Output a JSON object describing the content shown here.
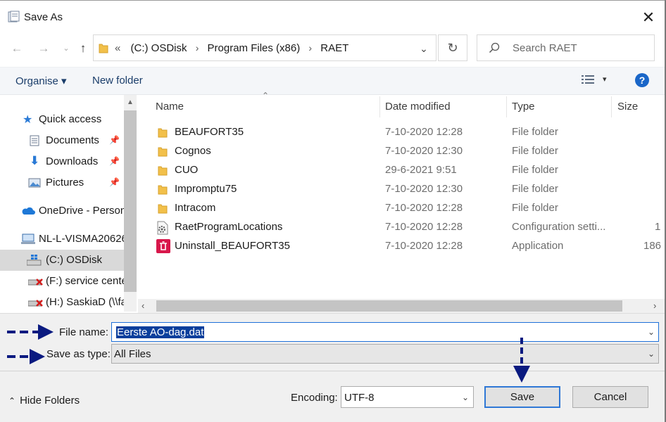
{
  "window": {
    "title": "Save As"
  },
  "address": {
    "crumbs": [
      "(C:) OSDisk",
      "Program Files (x86)",
      "RAET"
    ],
    "prefix": "«"
  },
  "search": {
    "placeholder": "Search RAET"
  },
  "toolbar": {
    "organise": "Organise ▾",
    "new_folder": "New folder"
  },
  "nav": {
    "items": [
      {
        "label": "Quick access",
        "icon": "star-icon"
      },
      {
        "label": "Documents",
        "icon": "documents-icon",
        "pinned": true
      },
      {
        "label": "Downloads",
        "icon": "download-arrow-icon",
        "pinned": true
      },
      {
        "label": "Pictures",
        "icon": "pictures-icon",
        "pinned": true
      },
      {
        "label": "OneDrive - Person",
        "icon": "cloud-icon"
      },
      {
        "label": "NL-L-VISMA20626",
        "icon": "computer-icon"
      },
      {
        "label": "(C:) OSDisk",
        "icon": "windows-drive-icon",
        "selected": true
      },
      {
        "label": "(F:) service cente",
        "icon": "network-drive-disconnected-icon"
      },
      {
        "label": "(H:) SaskiaD (\\\\fa",
        "icon": "network-drive-disconnected-icon"
      }
    ]
  },
  "columns": {
    "name": "Name",
    "date": "Date modified",
    "type": "Type",
    "size": "Size"
  },
  "files": [
    {
      "name": "BEAUFORT35",
      "date": "7-10-2020 12:28",
      "type": "File folder",
      "size": "",
      "icon": "folder-icon"
    },
    {
      "name": "Cognos",
      "date": "7-10-2020 12:30",
      "type": "File folder",
      "size": "",
      "icon": "folder-icon"
    },
    {
      "name": "CUO",
      "date": "29-6-2021 9:51",
      "type": "File folder",
      "size": "",
      "icon": "folder-icon"
    },
    {
      "name": "Impromptu75",
      "date": "7-10-2020 12:30",
      "type": "File folder",
      "size": "",
      "icon": "folder-icon"
    },
    {
      "name": "Intracom",
      "date": "7-10-2020 12:28",
      "type": "File folder",
      "size": "",
      "icon": "folder-icon"
    },
    {
      "name": "RaetProgramLocations",
      "date": "7-10-2020 12:28",
      "type": "Configuration setti...",
      "size": "1",
      "icon": "config-file-icon"
    },
    {
      "name": "Uninstall_BEAUFORT35",
      "date": "7-10-2020 12:28",
      "type": "Application",
      "size": "186",
      "icon": "uninstaller-icon"
    }
  ],
  "form": {
    "file_name_label": "File name:",
    "file_name_value": "Eerste AO-dag.dat",
    "save_type_label": "Save as type:",
    "save_type_value": "All Files"
  },
  "footer": {
    "hide_folders": "Hide Folders",
    "encoding_label": "Encoding:",
    "encoding_value": "UTF-8",
    "save": "Save",
    "cancel": "Cancel"
  },
  "colors": {
    "annotation_arrow": "#0a1a80",
    "accent": "#2f78d6",
    "selection": "#0a3f9c"
  }
}
